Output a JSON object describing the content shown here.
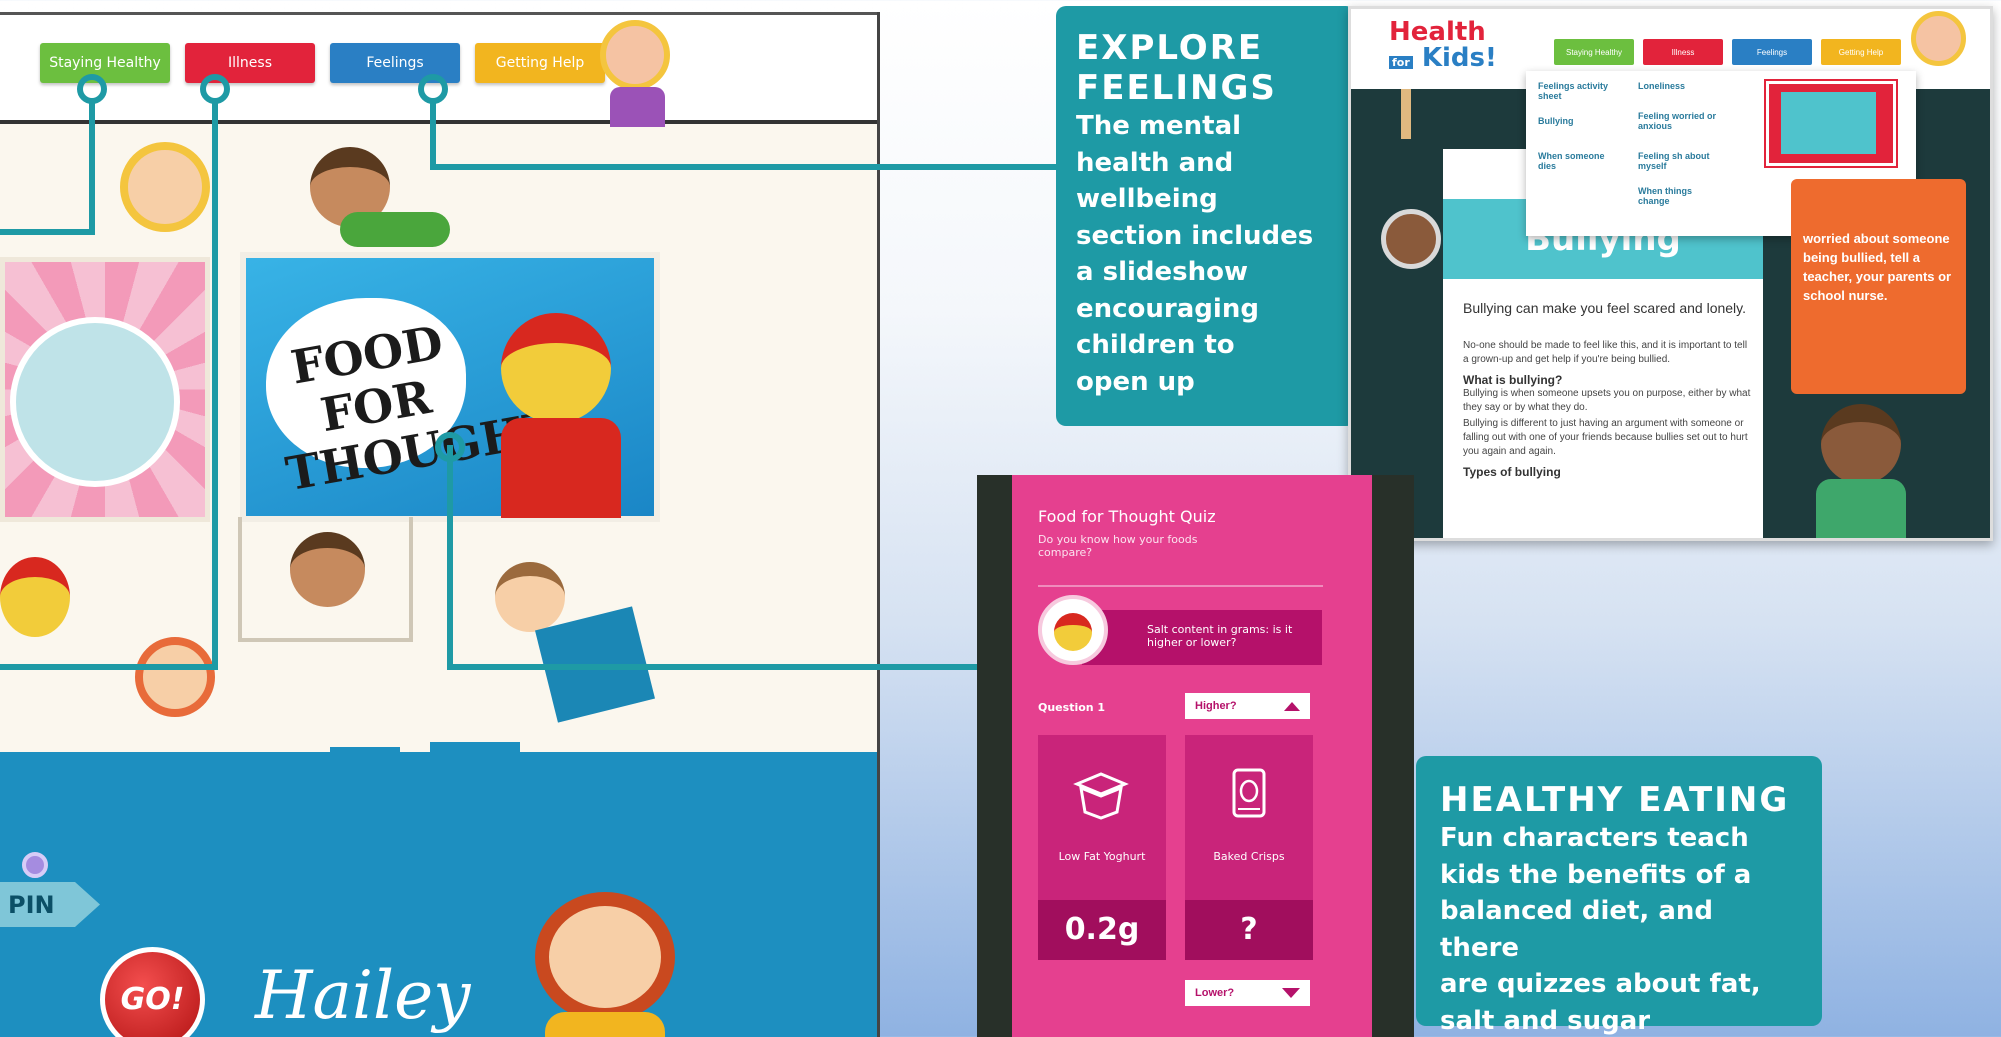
{
  "left_site": {
    "nav": [
      {
        "label": "Staying Healthy",
        "color": "#6cbf3f"
      },
      {
        "label": "Illness",
        "color": "#e2233b"
      },
      {
        "label": "Feelings",
        "color": "#2a7fc4"
      },
      {
        "label": "Getting Help",
        "color": "#f2b51f"
      }
    ],
    "food_title": "FOOD FOR THOUGHT",
    "pin_label": "PIN",
    "go_label": "GO!",
    "hailey_label": "Hailey"
  },
  "explore": {
    "heading_line1": "EXPLORE",
    "heading_line2": "FEELINGS",
    "body_lines": [
      "The mental",
      "health and",
      "wellbeing",
      "section includes",
      "a slideshow",
      "encouraging",
      "children to",
      "open up"
    ]
  },
  "healthy": {
    "heading": "HEALTHY EATING",
    "body_lines": [
      "Fun characters teach",
      "kids the benefits of a",
      "balanced diet, and there",
      "are quizzes about fat,",
      "salt and sugar"
    ]
  },
  "bully_site": {
    "logo_line1": "Health",
    "logo_for": "for",
    "logo_line2": "Kids!",
    "nav": [
      {
        "label": "Staying Healthy",
        "color": "#6cbf3f"
      },
      {
        "label": "Illness",
        "color": "#e2233b"
      },
      {
        "label": "Feelings",
        "color": "#2a7fc4"
      },
      {
        "label": "Getting Help",
        "color": "#f2b51f"
      }
    ],
    "dropdown_links": [
      "Feelings activity sheet",
      "Bullying",
      "When someone dies",
      "Loneliness",
      "Feeling worried or anxious",
      "Feeling sh about myself",
      "When things change"
    ],
    "card_title": "Bullying",
    "intro": "Bullying can make you feel scared and lonely.",
    "para1": "No-one should be made to feel like this, and it is important to tell a grown-up and get help if you're being bullied.",
    "subhead1": "What is bullying?",
    "para2": "Bullying is when someone upsets you on purpose, either by what they say or by what they do.",
    "para3": "Bullying is different to just having an argument with someone or falling out with one of your friends because bullies set out to hurt you again and again.",
    "subhead2": "Types of bullying",
    "bubble_text": "worried about someone being bullied, tell a teacher, your parents or school nurse."
  },
  "quiz": {
    "title": "Food for Thought Quiz",
    "subtitle": "Do you know how your foods compare?",
    "prompt": "Salt content in grams: is it higher or lower?",
    "question_label": "Question 1",
    "higher_label": "Higher?",
    "lower_label": "Lower?",
    "food1_name": "Low Fat Yoghurt",
    "food1_value": "0.2g",
    "food2_name": "Baked Crisps",
    "food2_value": "?"
  }
}
